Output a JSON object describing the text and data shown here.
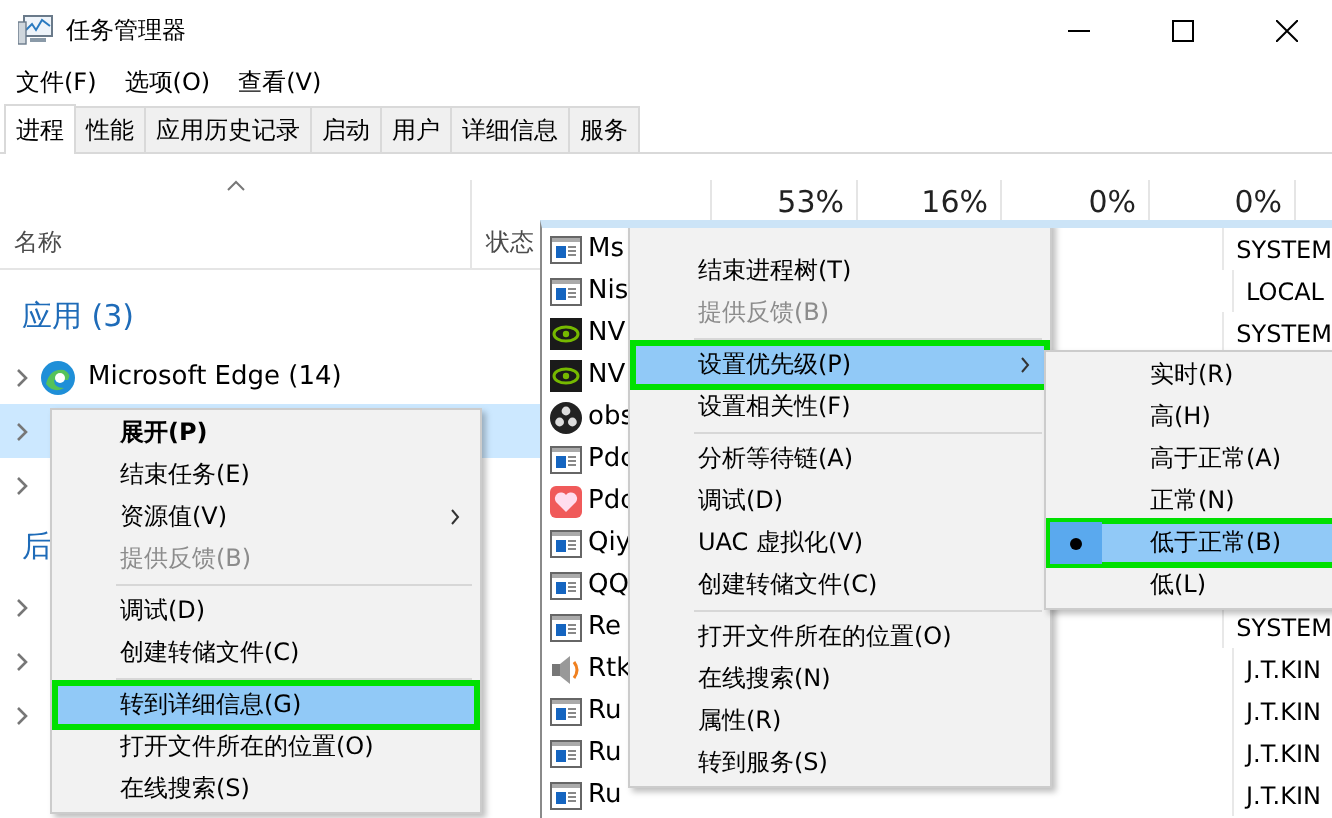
{
  "window": {
    "title": "任务管理器"
  },
  "menu_bar": [
    "文件(F)",
    "选项(O)",
    "查看(V)"
  ],
  "tabs": [
    {
      "label": "进程",
      "selected": true
    },
    {
      "label": "性能",
      "selected": false
    },
    {
      "label": "应用历史记录",
      "selected": false
    },
    {
      "label": "启动",
      "selected": false
    },
    {
      "label": "用户",
      "selected": false
    },
    {
      "label": "详细信息",
      "selected": false
    },
    {
      "label": "服务",
      "selected": false
    }
  ],
  "header": {
    "name_column": "名称",
    "status_column": "状态",
    "usage": [
      "53%",
      "16%",
      "0%",
      "0%"
    ]
  },
  "groups": [
    {
      "title": "应用 (3)",
      "rows": [
        {
          "kind": "edge",
          "name": "Microsoft Edge (14)",
          "selected": false
        },
        {
          "kind": "covered",
          "selected": true
        },
        {
          "kind": "covered",
          "selected": false
        }
      ]
    },
    {
      "title": "后",
      "rows": [
        {
          "kind": "covered",
          "selected": false
        },
        {
          "kind": "covered",
          "selected": false
        },
        {
          "kind": "covered",
          "selected": false
        }
      ]
    }
  ],
  "context_menu": [
    {
      "kind": "item",
      "label": "展开(P)",
      "bold": true
    },
    {
      "kind": "item",
      "label": "结束任务(E)"
    },
    {
      "kind": "item",
      "label": "资源值(V)",
      "submenu": true
    },
    {
      "kind": "item",
      "label": "提供反馈(B)",
      "disabled": true
    },
    {
      "kind": "separator"
    },
    {
      "kind": "item",
      "label": "调试(D)"
    },
    {
      "kind": "item",
      "label": "创建转储文件(C)"
    },
    {
      "kind": "separator"
    },
    {
      "kind": "item",
      "label": "转到详细信息(G)",
      "highlighted": true,
      "outlined": true
    },
    {
      "kind": "item",
      "label": "打开文件所在的位置(O)"
    },
    {
      "kind": "item",
      "label": "在线搜索(S)"
    }
  ],
  "details_rows": [
    {
      "kind": "window",
      "name": "Ms",
      "user": "SYSTEM"
    },
    {
      "kind": "window",
      "name": "Nis",
      "user": "LOCAL"
    },
    {
      "kind": "nvidia",
      "name": "NV",
      "user": "SYSTEM"
    },
    {
      "kind": "nvidia",
      "name": "NV"
    },
    {
      "kind": "obs",
      "name": "obs"
    },
    {
      "kind": "window",
      "name": "Pdc"
    },
    {
      "kind": "heart",
      "name": "Pdc"
    },
    {
      "kind": "window",
      "name": "Qiy"
    },
    {
      "kind": "window",
      "name": "QQ"
    },
    {
      "kind": "window",
      "name": "Re",
      "user": "SYSTEM"
    },
    {
      "kind": "speaker",
      "name": "Rtk",
      "user": "J.T.KIN"
    },
    {
      "kind": "window",
      "name": "Ru",
      "user": "J.T.KIN"
    },
    {
      "kind": "window",
      "name": "Ru",
      "user": "J.T.KIN"
    },
    {
      "kind": "window",
      "name": "Ru",
      "user": "J.T.KIN"
    }
  ],
  "details_menu": [
    {
      "kind": "item",
      "label": "结束进程树(T)"
    },
    {
      "kind": "item",
      "label": "提供反馈(B)",
      "disabled": true
    },
    {
      "kind": "separator"
    },
    {
      "kind": "item",
      "label": "设置优先级(P)",
      "submenu": true,
      "highlighted": true,
      "outlined": true
    },
    {
      "kind": "item",
      "label": "设置相关性(F)"
    },
    {
      "kind": "separator"
    },
    {
      "kind": "item",
      "label": "分析等待链(A)"
    },
    {
      "kind": "item",
      "label": "调试(D)"
    },
    {
      "kind": "item",
      "label": "UAC 虚拟化(V)"
    },
    {
      "kind": "item",
      "label": "创建转储文件(C)"
    },
    {
      "kind": "separator"
    },
    {
      "kind": "item",
      "label": "打开文件所在的位置(O)"
    },
    {
      "kind": "item",
      "label": "在线搜索(N)"
    },
    {
      "kind": "item",
      "label": "属性(R)"
    },
    {
      "kind": "item",
      "label": "转到服务(S)"
    }
  ],
  "priority_menu": [
    {
      "label": "实时(R)",
      "selected": false,
      "highlighted": false,
      "outlined": false
    },
    {
      "label": "高(H)",
      "selected": false,
      "highlighted": false,
      "outlined": false
    },
    {
      "label": "高于正常(A)",
      "selected": false,
      "highlighted": false,
      "outlined": false
    },
    {
      "label": "正常(N)",
      "selected": false,
      "highlighted": false,
      "outlined": false
    },
    {
      "label": "低于正常(B)",
      "selected": true,
      "highlighted": true,
      "outlined": true
    },
    {
      "label": "低(L)",
      "selected": false,
      "highlighted": false,
      "outlined": false
    }
  ]
}
